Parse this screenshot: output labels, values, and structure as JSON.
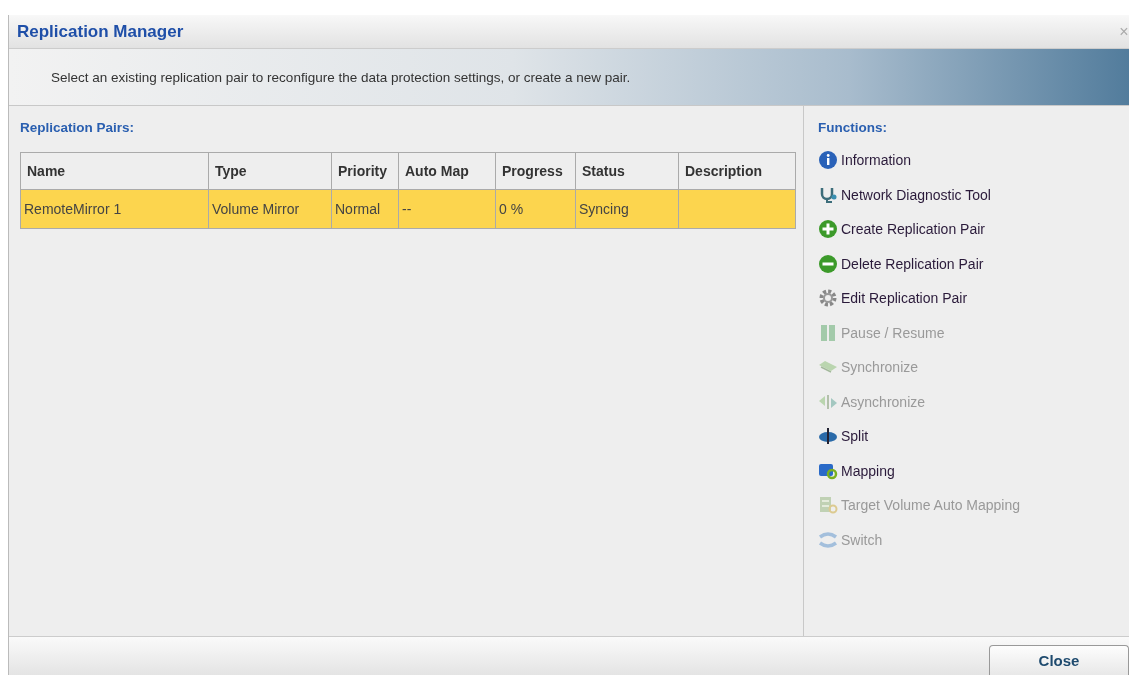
{
  "window": {
    "title": "Replication Manager",
    "close_glyph": "×"
  },
  "banner": {
    "text": "Select an existing replication pair to reconfigure the data protection settings, or create a new pair."
  },
  "pairs": {
    "heading": "Replication Pairs:",
    "columns": [
      "Name",
      "Type",
      "Priority",
      "Auto Map",
      "Progress",
      "Status",
      "Description"
    ],
    "rows": [
      {
        "selected": true,
        "cells": [
          "RemoteMirror 1",
          "Volume Mirror",
          "Normal",
          "--",
          "0 %",
          "Syncing",
          ""
        ]
      }
    ]
  },
  "functions": {
    "heading": "Functions:",
    "items": [
      {
        "kind": "info",
        "label": "Information",
        "disabled": false
      },
      {
        "kind": "diagnostic",
        "label": "Network Diagnostic Tool",
        "disabled": false
      },
      {
        "kind": "add",
        "label": "Create Replication Pair",
        "disabled": false
      },
      {
        "kind": "remove",
        "label": "Delete Replication Pair",
        "disabled": false
      },
      {
        "kind": "gear",
        "label": "Edit Replication Pair",
        "disabled": false
      },
      {
        "kind": "pause",
        "label": "Pause / Resume",
        "disabled": true
      },
      {
        "kind": "sync",
        "label": "Synchronize",
        "disabled": true
      },
      {
        "kind": "async",
        "label": "Asynchronize",
        "disabled": true
      },
      {
        "kind": "split",
        "label": "Split",
        "disabled": false
      },
      {
        "kind": "mapping",
        "label": "Mapping",
        "disabled": false
      },
      {
        "kind": "automap",
        "label": "Target Volume Auto Mapping",
        "disabled": true
      },
      {
        "kind": "switch",
        "label": "Switch",
        "disabled": true
      }
    ]
  },
  "buttons": [
    "Close"
  ]
}
